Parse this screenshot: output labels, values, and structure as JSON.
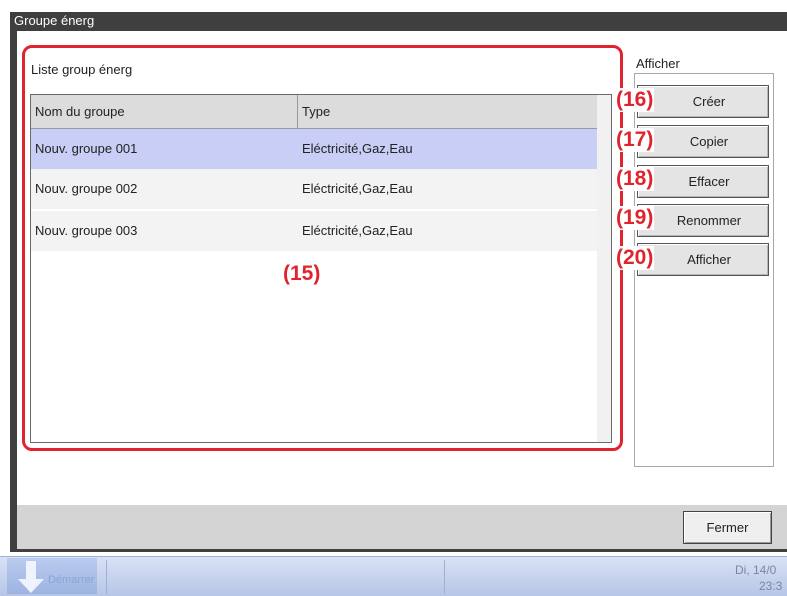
{
  "window": {
    "title": "Groupe énerg"
  },
  "list": {
    "label": "Liste group énerg",
    "columns": [
      "Nom du groupe",
      "Type"
    ],
    "rows": [
      {
        "name": "Nouv. groupe 001",
        "type": "Eléctricité,Gaz,Eau",
        "selected": true
      },
      {
        "name": "Nouv. groupe 002",
        "type": "Eléctricité,Gaz,Eau",
        "selected": false
      },
      {
        "name": "Nouv. groupe 003",
        "type": "Eléctricité,Gaz,Eau",
        "selected": false
      }
    ]
  },
  "side_panel": {
    "label": "Afficher",
    "buttons": [
      "Créer",
      "Copier",
      "Effacer",
      "Renommer",
      "Afficher"
    ]
  },
  "annotations": {
    "list": "(15)",
    "buttons": [
      "(16)",
      "(17)",
      "(18)",
      "(19)",
      "(20)"
    ]
  },
  "footer": {
    "close_label": "Fermer"
  },
  "taskbar": {
    "start_label": "Démarrer",
    "clock_date": "Di, 14/0",
    "clock_time": "23:3"
  },
  "colors": {
    "annotation_red": "#e0242e",
    "selected_row": "#c8cef5",
    "frame": "#3f3f3f"
  }
}
